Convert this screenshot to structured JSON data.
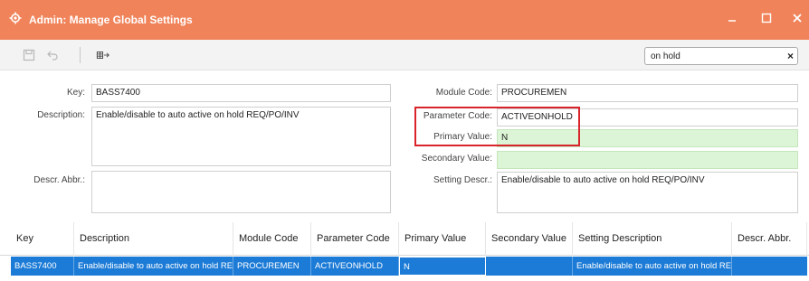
{
  "window": {
    "title": "Admin: Manage Global Settings",
    "icon": "gear-icon",
    "controls": [
      "minimize-icon",
      "maximize-icon",
      "close-icon"
    ],
    "accent_color": "#f0835a"
  },
  "toolbar": {
    "buttons": [
      "save-icon",
      "undo-icon",
      "export-icon"
    ],
    "search": {
      "value": "on hold",
      "clear_label": "×"
    }
  },
  "form": {
    "key_label": "Key:",
    "key_value": "BASS7400",
    "description_label": "Description:",
    "description_value": "Enable/disable to auto active on hold REQ/PO/INV",
    "descr_abbr_label": "Descr. Abbr.:",
    "descr_abbr_value": "",
    "module_code_label": "Module Code:",
    "module_code_value": "PROCUREMEN",
    "parameter_code_label": "Parameter Code:",
    "parameter_code_value": "ACTIVEONHOLD",
    "primary_value_label": "Primary Value:",
    "primary_value_value": "N",
    "secondary_value_label": "Secondary Value:",
    "secondary_value_value": "",
    "setting_descr_label": "Setting Descr.:",
    "setting_descr_value": "Enable/disable to auto active on hold REQ/PO/INV"
  },
  "grid": {
    "columns": [
      "Key",
      "Description",
      "Module Code",
      "Parameter Code",
      "Primary Value",
      "Secondary Value",
      "Setting Description",
      "Descr. Abbr."
    ],
    "rows": [
      {
        "key": "BASS7400",
        "description": "Enable/disable to auto active on hold REQ/PO/INV",
        "module_code": "PROCUREMEN",
        "parameter_code": "ACTIVEONHOLD",
        "primary_value": "N",
        "secondary_value": "",
        "setting_description": "Enable/disable to auto active on hold REQ/PO/INV",
        "descr_abbr": ""
      }
    ],
    "selected_row_color": "#1c7bd6"
  }
}
